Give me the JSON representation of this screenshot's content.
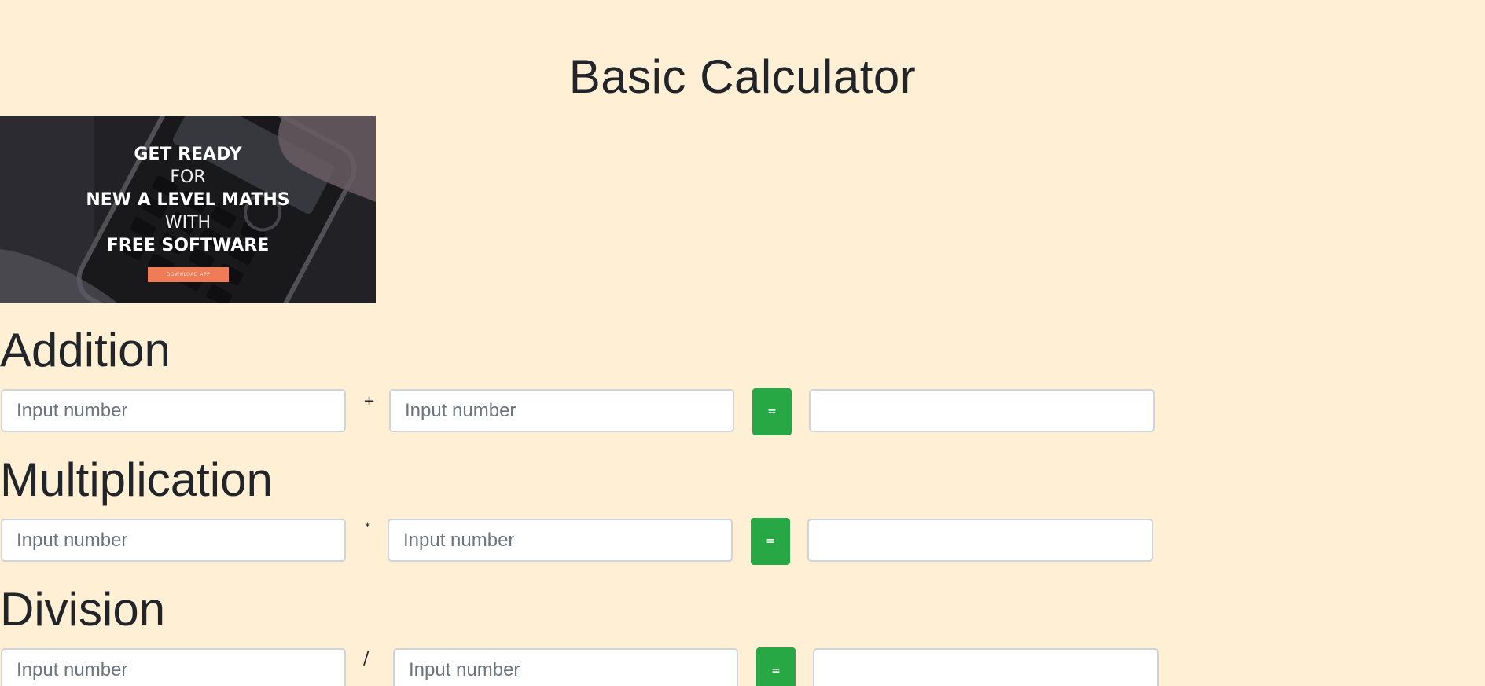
{
  "page": {
    "title": "Basic Calculator",
    "background_color": "#ffefd5"
  },
  "banner": {
    "lines": [
      "GET READY",
      "FOR",
      "NEW A LEVEL MATHS",
      "WITH",
      "FREE SOFTWARE"
    ],
    "button_label": "DOWNLOAD APP",
    "button_color": "#ee7d57"
  },
  "sections": [
    {
      "heading": "Addition",
      "operator": "+",
      "input_a_placeholder": "Input number",
      "input_b_placeholder": "Input number",
      "equals_label": "=",
      "result_value": ""
    },
    {
      "heading": "Multiplication",
      "operator": "*",
      "input_a_placeholder": "Input number",
      "input_b_placeholder": "Input number",
      "equals_label": "=",
      "result_value": ""
    },
    {
      "heading": "Division",
      "operator": "/",
      "input_a_placeholder": "Input number",
      "input_b_placeholder": "Input number",
      "equals_label": "=",
      "result_value": ""
    }
  ],
  "colors": {
    "equals_button": "#28a745",
    "input_border": "#ced4da",
    "text": "#212529"
  }
}
